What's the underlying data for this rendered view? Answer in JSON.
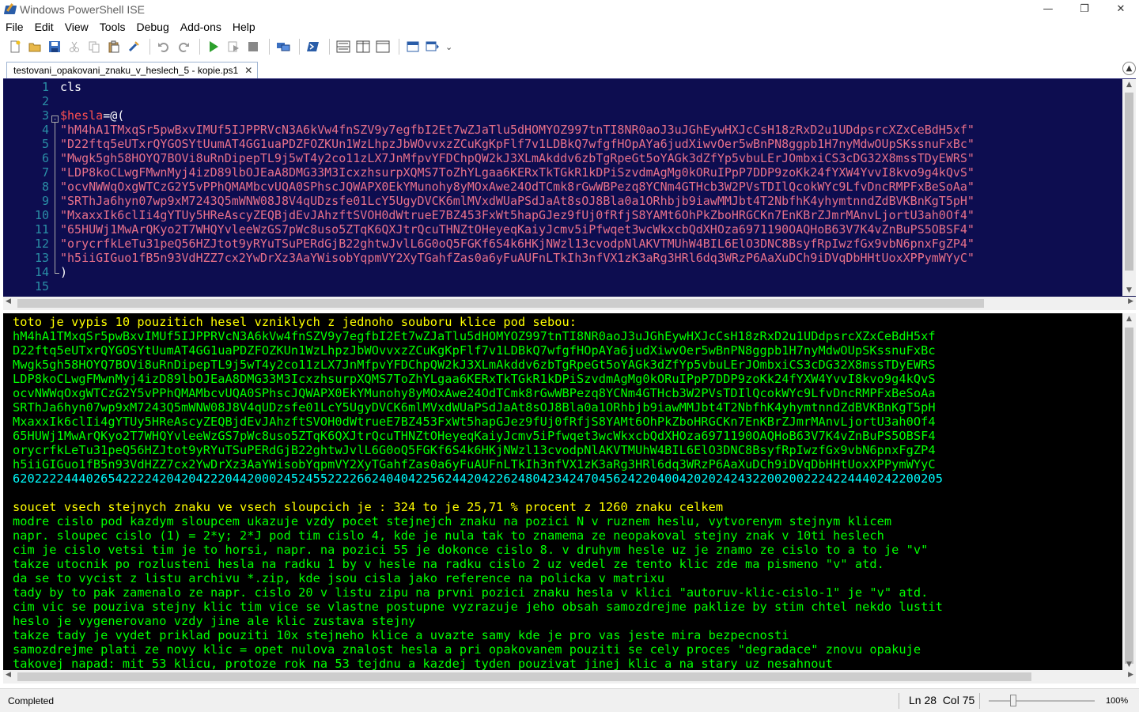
{
  "window": {
    "title": "Windows PowerShell ISE",
    "minimize": "—",
    "restore": "❐",
    "close": "✕"
  },
  "menu": [
    "File",
    "Edit",
    "View",
    "Tools",
    "Debug",
    "Add-ons",
    "Help"
  ],
  "toolbar": {
    "icons": [
      "new-file-icon",
      "open-folder-icon",
      "save-icon",
      "cut-icon",
      "copy-icon",
      "paste-icon",
      "clear-console-icon",
      "undo-icon",
      "redo-icon",
      "run-script-icon",
      "run-selection-icon",
      "stop-icon",
      "new-remote-tab-icon",
      "start-powershell-icon",
      "show-script-pane-top-icon",
      "show-script-pane-right-icon",
      "show-script-pane-max-icon",
      "show-command-window-icon",
      "show-command-addon-icon"
    ],
    "overflow": "⌄"
  },
  "tab": {
    "label": "testovani_opakovani_znaku_v_heslech_5 - kopie.ps1",
    "close": "✕"
  },
  "editor": {
    "line_numbers": [
      "1",
      "2",
      "3",
      "4",
      "5",
      "6",
      "7",
      "8",
      "9",
      "10",
      "11",
      "12",
      "13",
      "14",
      "15"
    ],
    "fold_marker": "-",
    "line1": "cls",
    "line3_var": "$hesla",
    "line3_op": "=@(",
    "strings": [
      "\"hM4hA1TMxqSr5pwBxvIMUf5IJPPRVcN3A6kVw4fnSZV9y7egfbI2Et7wZJaTlu5dHOMYOZ997tnTI8NR0aoJ3uJGhEywHXJcCsH18zRxD2u1UDdpsrcXZxCeBdH5xf\"",
      "\"D22ftq5eUTxrQYGOSYtUumAT4GG1uaPDZFOZKUn1WzLhpzJbWOvvxzZCuKgKpFlf7v1LDBkQ7wfgfHOpAYa6judXiwvOer5wBnPN8ggpb1H7nyMdwOUpSKssnuFxBc\"",
      "\"Mwgk5gh58HOYQ7BOVi8uRnDipepTL9j5wT4y2co11zLX7JnMfpvYFDChpQW2kJ3XLmAkddv6zbTgRpeGt5oYAGk3dZfYp5vbuLErJOmbxiCS3cDG32X8mssTDyEWRS\"",
      "\"LDP8koCLwgFMwnMyj4izD89lbOJEaA8DMG33M3IcxzhsurpXQMS7ToZhYLgaa6KERxTkTGkR1kDPiSzvdmAgMg0kORuIPpP7DDP9zoKk24fYXW4YvvI8kvo9g4kQvS\"",
      "\"ocvNWWqOxgWTCzG2Y5vPPhQMAMbcvUQA0SPhscJQWAPX0EkYMunohy8yMOxAwe24OdTCmk8rGwWBPezq8YCNm4GTHcb3W2PVsTDIlQcokWYc9LfvDncRMPFxBeSoAa\"",
      "\"SRThJa6hyn07wp9xM7243Q5mWNW08J8V4qUDzsfe01LcY5UgyDVCK6mlMVxdWUaPSdJaAt8sOJ8Bla0a1ORhbjb9iawMMJbt4T2NbfhK4yhymtnndZdBVKBnKgT5pH\"",
      "\"MxaxxIk6clIi4gYTUy5HReAscyZEQBjdEvJAhzftSVOH0dWtrueE7BZ453FxWt5hapGJez9fUj0fRfjS8YAMt6OhPkZboHRGCKn7EnKBrZJmrMAnvLjortU3ah0Of4\"",
      "\"65HUWj1MwArQKyo2T7WHQYvleeWzGS7pWc8uso5ZTqK6QXJtrQcuTHNZtOHeyeqKaiyJcmv5iPfwqet3wcWkxcbQdXHOza6971190OAQHoB63V7K4vZnBuPS5OBSF4\"",
      "\"orycrfkLeTu31peQ56HZJtot9yRYuTSuPERdGjB22ghtwJvlL6G0oQ5FGKf6S4k6HKjNWzl13cvodpNlAKVTMUhW4BIL6ElO3DNC8BsyfRpIwzfGx9vbN6pnxFgZP4\"",
      "\"h5iiGIGuo1fB5n93VdHZZ7cx2YwDrXz3AaYWisobYqpmVY2XyTGahfZas0a6yFuAUFnLTkIh3nfVX1zK3aRg3HRl6dq3WRzP6AaXuDCh9iDVqDbHHtUoxXPPymWYyC\""
    ],
    "line14": ")"
  },
  "console": {
    "header": "toto je vypis 10 pouzitich hesel vzniklych z jednoho souboru klice pod sebou:",
    "passwords": [
      "hM4hA1TMxqSr5pwBxvIMUf5IJPPRVcN3A6kVw4fnSZV9y7egfbI2Et7wZJaTlu5dHOMYOZ997tnTI8NR0aoJ3uJGhEywHXJcCsH18zRxD2u1UDdpsrcXZxCeBdH5xf",
      "D22ftq5eUTxrQYGOSYtUumAT4GG1uaPDZFOZKUn1WzLhpzJbWOvvxzZCuKgKpFlf7v1LDBkQ7wfgfHOpAYa6judXiwvOer5wBnPN8ggpb1H7nyMdwOUpSKssnuFxBc",
      "Mwgk5gh58HOYQ7BOVi8uRnDipepTL9j5wT4y2co11zLX7JnMfpvYFDChpQW2kJ3XLmAkddv6zbTgRpeGt5oYAGk3dZfYp5vbuLErJOmbxiCS3cDG32X8mssTDyEWRS",
      "LDP8koCLwgFMwnMyj4izD89lbOJEaA8DMG33M3IcxzhsurpXQMS7ToZhYLgaa6KERxTkTGkR1kDPiSzvdmAgMg0kORuIPpP7DDP9zoKk24fYXW4YvvI8kvo9g4kQvS",
      "ocvNWWqOxgWTCzG2Y5vPPhQMAMbcvUQA0SPhscJQWAPX0EkYMunohy8yMOxAwe24OdTCmk8rGwWBPezq8YCNm4GTHcb3W2PVsTDIlQcokWYc9LfvDncRMPFxBeSoAa",
      "SRThJa6hyn07wp9xM7243Q5mWNW08J8V4qUDzsfe01LcY5UgyDVCK6mlMVxdWUaPSdJaAt8sOJ8Bla0a1ORhbjb9iawMMJbt4T2NbfhK4yhymtnndZdBVKBnKgT5pH",
      "MxaxxIk6clIi4gYTUy5HReAscyZEQBjdEvJAhzftSVOH0dWtrueE7BZ453FxWt5hapGJez9fUj0fRfjS8YAMt6OhPkZboHRGCKn7EnKBrZJmrMAnvLjortU3ah0Of4",
      "65HUWj1MwArQKyo2T7WHQYvleeWzGS7pWc8uso5ZTqK6QXJtrQcuTHNZtOHeyeqKaiyJcmv5iPfwqet3wcWkxcbQdXHOza6971190OAQHoB63V7K4vZnBuPS5OBSF4",
      "orycrfkLeTu31peQ56HZJtot9yRYuTSuPERdGjB22ghtwJvlL6G0oQ5FGKf6S4k6HKjNWzl13cvodpNlAKVTMUhW4BIL6ElO3DNC8BsyfRpIwzfGx9vbN6pnxFgZP4",
      "h5iiGIGuo1fB5n93VdHZZ7cx2YwDrXz3AaYWisobYqpmVY2XyTGahfZas0a6yFuAUFnLTkIh3nfVX1zK3aRg3HRl6dq3WRzP6AaXuDCh9iDVqDbHHtUoxXPPymWYyC"
    ],
    "counts": "6202222444026542222420420422204420002452455222266240404225624420422624804234247045624220400420202424322002002224224440242200205",
    "summary": "soucet vsech stejnych znaku ve vsech sloupcich je : 324 to je 25,71 % procent z 1260 znaku celkem",
    "notes": [
      "modre cislo pod kazdym sloupcem ukazuje vzdy pocet stejnejch znaku na pozici N v ruznem heslu, vytvorenym stejnym klicem",
      "napr. sloupec cislo (1) = 2*y; 2*J pod tim cislo 4, kde je nula tak to znamema ze neopakoval stejny znak v 10ti heslech",
      "cim je cislo vetsi tim je to horsi, napr. na pozici 55 je dokonce cislo 8. v druhym hesle uz je znamo ze cislo to a to je \"v\"",
      "takze utocnik po rozlusteni hesla na radku 1 by v hesle na radku cislo 2 uz vedel ze tento klic zde ma pismeno \"v\" atd.",
      "da se to vycist z listu archivu *.zip, kde jsou cisla jako reference na policka v matrixu",
      "tady by to pak zamenalo ze napr. cislo 20 v listu zipu na prvni pozici znaku hesla v klici \"autoruv-klic-cislo-1\" je \"v\" atd.",
      "cim vic se pouziva stejny klic tim vice se vlastne postupne vyzrazuje jeho obsah samozdrejme paklize by stim chtel nekdo lustit",
      "heslo je vygenerovano vzdy jine ale klic zustava stejny",
      "takze tady je vydet priklad pouziti 10x stejneho klice a uvazte samy kde je pro vas jeste mira bezpecnosti",
      "samozdrejme plati ze novy klic = opet nulova znalost hesla a pri opakovanem pouziti se cely proces \"degradace\" znovu opakuje",
      "takovej napad: mit 53 klicu, protoze rok na 53 tejdnu a kazdej tyden pouzivat jinej klic a na stary uz nesahnout"
    ]
  },
  "status": {
    "text": "Completed",
    "position": "Ln 28  Col 75",
    "zoom": "100%",
    "zoom_level_percent": 100
  },
  "colors": {
    "editor_bg": "#0d0d50",
    "console_bg": "#000000",
    "string": "#e8708a",
    "variable": "#ff5050",
    "console_yellow": "#ffff00",
    "console_green": "#00ff00",
    "console_cyan": "#00ffff",
    "line_number": "#2a8ea6"
  }
}
